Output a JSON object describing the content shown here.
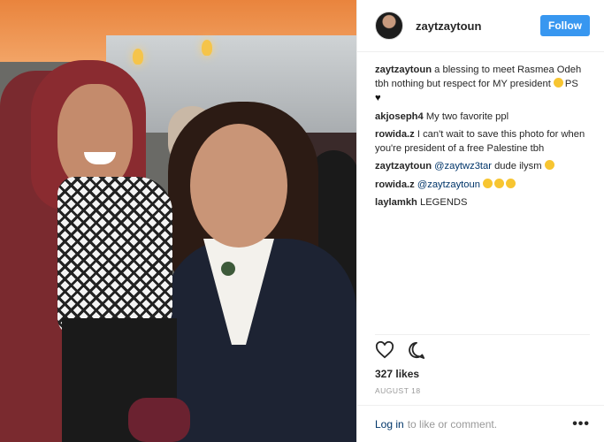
{
  "post": {
    "username": "zaytzaytoun",
    "follow_label": "Follow"
  },
  "comments": [
    {
      "user": "zaytzaytoun",
      "text": "a blessing to meet Rasmea Odeh tbh nothing but respect for MY president",
      "tail": "PS",
      "heart": "♥"
    },
    {
      "user": "akjoseph4",
      "text": "My two favorite ppl"
    },
    {
      "user": "rowida.z",
      "text": "I can't wait to save this photo for when you're president of a free Palestine tbh"
    },
    {
      "user": "zaytzaytoun",
      "mention": "@zaytwz3tar",
      "text": "dude ilysm"
    },
    {
      "user": "rowida.z",
      "mention": "@zaytzaytoun"
    },
    {
      "user": "laylamkh",
      "text": "LEGENDS"
    }
  ],
  "likes": "327 likes",
  "date": "AUGUST 18",
  "footer": {
    "login": "Log in",
    "rest": "to like or comment.",
    "more": "•••"
  }
}
